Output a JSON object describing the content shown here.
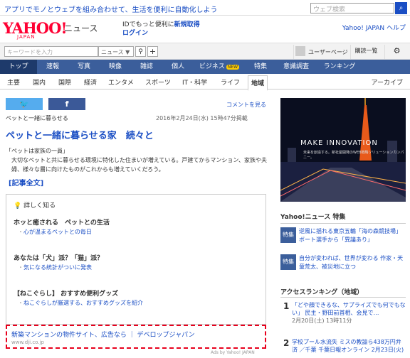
{
  "topbar": {
    "promo": "アプリでモノとウェブを組み合わせて、生活を便利に自動化しよう",
    "search_placeholder": "ウェブ検索"
  },
  "header": {
    "logo": "YAHOO!",
    "logo_sub": "JAPAN",
    "title": "ニュース",
    "id_prefix": "IDでもっと便利に",
    "id_link": "新規取得",
    "login": "ログイン",
    "links": "Yahoo! JAPAN ヘルプ"
  },
  "searchbar": {
    "keyword_placeholder": "キーワードを入力",
    "category": "ニュース ▼",
    "search_icon": "magnifier-icon",
    "add": "+",
    "user_page": "ユーザーページ",
    "subscribe": "購読一覧",
    "settings_icon": "gear-icon"
  },
  "nav": [
    {
      "label": "トップ"
    },
    {
      "label": "速報"
    },
    {
      "label": "写真"
    },
    {
      "label": "映像"
    },
    {
      "label": "雑誌"
    },
    {
      "label": "個人"
    },
    {
      "label": "ビジネス",
      "badge": "NEW"
    },
    {
      "label": "特集"
    },
    {
      "label": "意識調査"
    },
    {
      "label": "ランキング"
    }
  ],
  "subnav": [
    "主要",
    "国内",
    "国際",
    "経済",
    "エンタメ",
    "スポーツ",
    "IT・科学",
    "ライフ",
    "地域"
  ],
  "archive": "アーカイブ",
  "article": {
    "comment_link": "コメントを見る",
    "source": "ペットと一緒に暮らせる",
    "date": "2016年2月24日(水) 15時47分掲載",
    "headline": "ペットと一緒に暮らせる家　続々と",
    "quote": "「ペットは家族の一員」",
    "body": "大切なペットと共に暮らせる環境に特化した住まいが増えている。戸建てからマンション、家族や夫婦、様々な層に向けたものがこれからも増えていくだろう。",
    "full_text": "[記事全文]"
  },
  "related": {
    "header": "詳しく知る",
    "items": [
      {
        "title": "ホッと癒される　ペットとの生活",
        "link": "心が温まるペットとの毎日"
      },
      {
        "title": "あなたは「犬」派？「猫」派？",
        "link": "気になる統計がついに発表"
      },
      {
        "title": "【ねこぐらし】 おすすめ便利グッズ",
        "link": "ねこぐらしが厳選する、おすすめグッズを紹介"
      }
    ]
  },
  "ad": {
    "line1": "新築マンションの物件サイト、広告なら ｜ デベロップジャパン",
    "line2": "www.dji.co.jp",
    "ads_by": "Ads by Yahoo! JAPAN"
  },
  "banner": {
    "make": "MAKE INNOVATION",
    "tag": "未来を創造する。新社屋開発のWEB戦略ソリューションカンパニー。"
  },
  "feature": {
    "title": "Yahoo!ニュース 特集",
    "items": [
      {
        "thumb": "特集",
        "text": "逆風に揺れる東京五輪「海の森競技場」ボート選手から「異議あり」"
      },
      {
        "thumb": "特集",
        "text": "自分が変われば、世界が変わる 作家・天童荒太、被災地に立つ"
      }
    ]
  },
  "ranking": {
    "title": "アクセスランキング（地域）",
    "items": [
      {
        "rank": "1",
        "text": "「どや顔できるな、サプライズでも何でもない」 民主・野田前首相、会見で…",
        "meta": "2月20日(土) 13時11分"
      },
      {
        "rank": "2",
        "text": "学校プール水流失 ミスの教諭ら438万円弁済 ／千葉 千葉日報オンライン 2月23日(火)",
        "meta": ""
      }
    ]
  }
}
